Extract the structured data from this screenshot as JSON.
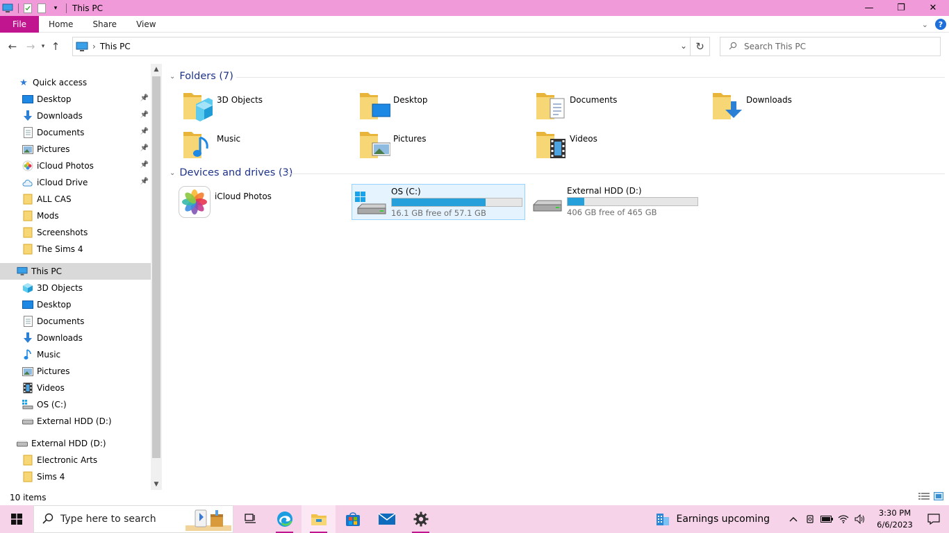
{
  "window": {
    "title": "This PC",
    "controls": {
      "minimize": "—",
      "maximize": "❐",
      "close": "✕"
    }
  },
  "ribbon": {
    "tabs": [
      "File",
      "Home",
      "Share",
      "View"
    ],
    "help": "?"
  },
  "address": {
    "crumb": "This PC",
    "separator": "›"
  },
  "search": {
    "placeholder": "Search This PC"
  },
  "sidebar": {
    "quick_access": {
      "label": "Quick access",
      "items": [
        {
          "label": "Desktop",
          "pinned": true,
          "icon": "desktop-icon"
        },
        {
          "label": "Downloads",
          "pinned": true,
          "icon": "downloads-icon"
        },
        {
          "label": "Documents",
          "pinned": true,
          "icon": "documents-icon"
        },
        {
          "label": "Pictures",
          "pinned": true,
          "icon": "pictures-icon"
        },
        {
          "label": "iCloud Photos",
          "pinned": true,
          "icon": "icloud-photos-icon"
        },
        {
          "label": "iCloud Drive",
          "pinned": true,
          "icon": "icloud-drive-icon"
        },
        {
          "label": "ALL CAS",
          "pinned": false,
          "icon": "folder-icon"
        },
        {
          "label": "Mods",
          "pinned": false,
          "icon": "folder-icon"
        },
        {
          "label": "Screenshots",
          "pinned": false,
          "icon": "folder-icon"
        },
        {
          "label": "The Sims 4",
          "pinned": false,
          "icon": "folder-icon"
        }
      ]
    },
    "this_pc": {
      "label": "This PC",
      "items": [
        {
          "label": "3D Objects",
          "icon": "3d-objects-icon"
        },
        {
          "label": "Desktop",
          "icon": "desktop-icon"
        },
        {
          "label": "Documents",
          "icon": "documents-icon"
        },
        {
          "label": "Downloads",
          "icon": "downloads-icon"
        },
        {
          "label": "Music",
          "icon": "music-icon"
        },
        {
          "label": "Pictures",
          "icon": "pictures-icon"
        },
        {
          "label": "Videos",
          "icon": "videos-icon"
        },
        {
          "label": "OS (C:)",
          "icon": "os-drive-icon"
        },
        {
          "label": "External HDD (D:)",
          "icon": "hdd-icon"
        }
      ]
    },
    "external": {
      "label": "External HDD (D:)",
      "items": [
        {
          "label": "Electronic Arts",
          "icon": "folder-icon"
        },
        {
          "label": "Sims 4",
          "icon": "folder-icon"
        }
      ]
    }
  },
  "content": {
    "folders_header": "Folders (7)",
    "folders": [
      "3D Objects",
      "Desktop",
      "Documents",
      "Downloads",
      "Music",
      "Pictures",
      "Videos"
    ],
    "devices_header": "Devices and drives (3)",
    "devices": [
      {
        "name": "iCloud Photos",
        "type": "app"
      },
      {
        "name": "OS (C:)",
        "free": "16.1 GB free of 57.1 GB",
        "used_fraction": 0.72
      },
      {
        "name": "External HDD (D:)",
        "free": "406 GB free of 465 GB",
        "used_fraction": 0.13
      }
    ]
  },
  "status": {
    "count": "10 items"
  },
  "taskbar": {
    "search_placeholder": "Type here to search",
    "news": "Earnings upcoming",
    "time": "3:30 PM",
    "date": "6/6/2023"
  },
  "colors": {
    "title_bar": "#f19ad9",
    "file_tab": "#c0158f",
    "taskbar": "#f7d3ea",
    "header_text": "#1e3287",
    "drive_fill": "#26a0da"
  }
}
